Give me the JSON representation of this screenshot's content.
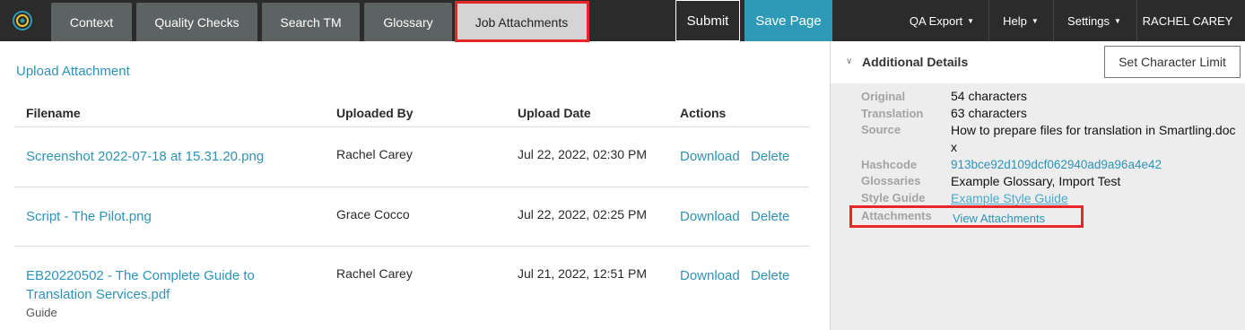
{
  "topbar": {
    "tabs": [
      {
        "label": "Context"
      },
      {
        "label": "Quality Checks"
      },
      {
        "label": "Search TM"
      },
      {
        "label": "Glossary"
      },
      {
        "label": "Job Attachments"
      }
    ],
    "submit_label": "Submit",
    "save_label": "Save Page",
    "menus": {
      "qa_export": "QA Export",
      "help": "Help",
      "settings": "Settings",
      "user": "RACHEL CAREY"
    }
  },
  "attachments": {
    "upload_label": "Upload Attachment",
    "columns": {
      "filename": "Filename",
      "uploaded_by": "Uploaded By",
      "upload_date": "Upload Date",
      "actions": "Actions"
    },
    "rows": [
      {
        "filename": "Screenshot 2022-07-18 at 15.31.20.png",
        "uploaded_by": "Rachel Carey",
        "date": "Jul 22, 2022, 02:30 PM",
        "download": "Download",
        "delete": "Delete"
      },
      {
        "filename": "Script - The Pilot.png",
        "uploaded_by": "Grace Cocco",
        "date": "Jul 22, 2022, 02:25 PM",
        "download": "Download",
        "delete": "Delete"
      },
      {
        "filename": "EB20220502 - The Complete Guide to Translation Services.pdf",
        "subtext": "Guide",
        "uploaded_by": "Rachel Carey",
        "date": "Jul 21, 2022, 12:51 PM",
        "download": "Download",
        "delete": "Delete"
      }
    ]
  },
  "details": {
    "title": "Additional Details",
    "set_limit_label": "Set Character Limit",
    "fields": {
      "original": {
        "label": "Original",
        "value": "54 characters"
      },
      "translation": {
        "label": "Translation",
        "value": "63 characters"
      },
      "source": {
        "label": "Source",
        "value": "How to prepare files for translation in Smartling.docx"
      },
      "hashcode": {
        "label": "Hashcode",
        "value": "913bce92d109dcf062940ad9a96a4e42"
      },
      "glossaries": {
        "label": "Glossaries",
        "value": "Example Glossary, Import Test"
      },
      "style_guide": {
        "label": "Style Guide",
        "value": "Example Style Guide"
      },
      "attachments": {
        "label": "Attachments",
        "value": "View Attachments"
      }
    }
  },
  "colors": {
    "accent": "#2e9ab8",
    "highlight": "#e8262a",
    "topbar": "#2b2b2b"
  }
}
